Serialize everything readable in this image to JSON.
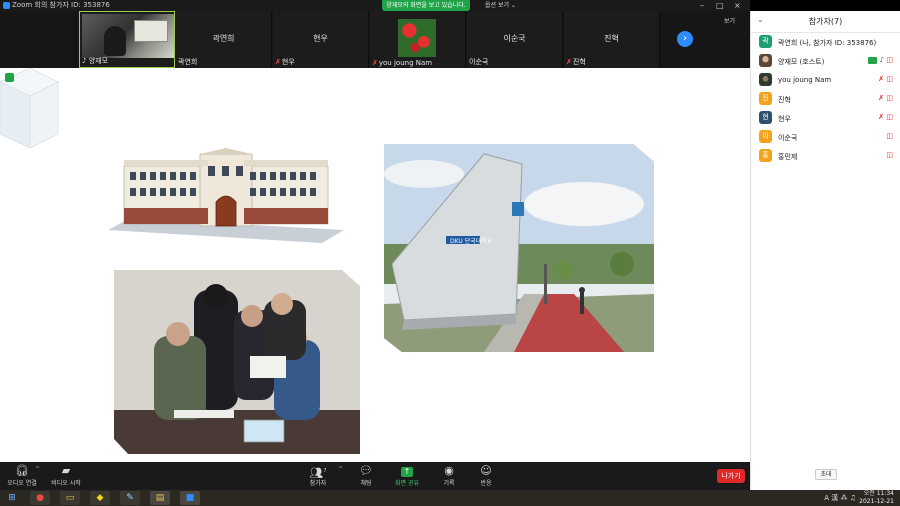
{
  "titlebar": {
    "app_title": "Zoom 회의 참가자 ID: 353876",
    "share_banner": "양재모의 화면을 보고 있습니다.",
    "view_options": "옵션 보기 ⌄",
    "minimize": "–",
    "maximize": "□",
    "close": "×"
  },
  "video_strip": {
    "tiles": [
      {
        "name": "양재모",
        "center_name": "",
        "muted": false,
        "active": true
      },
      {
        "name": "곽연희",
        "center_name": "곽연희",
        "muted": false,
        "active": false
      },
      {
        "name": "현우",
        "center_name": "현우",
        "muted": true,
        "active": false
      },
      {
        "name": "you joung Nam",
        "center_name": "",
        "muted": true,
        "active": false
      },
      {
        "name": "이순국",
        "center_name": "이순국",
        "muted": false,
        "active": false
      },
      {
        "name": "진혁",
        "center_name": "진혁",
        "muted": true,
        "active": false
      }
    ],
    "next_label": "›",
    "layout_button": "보기"
  },
  "toolbar": {
    "audio": "오디오 연결",
    "video": "비디오 시작",
    "participants": "참가자",
    "participants_count": "7",
    "chat": "채팅",
    "share": "화면 공유",
    "record": "기록",
    "reactions": "반응",
    "leave": "나가기"
  },
  "panel": {
    "title": "참가자(7)",
    "collapse_arrow": "⌄",
    "participants": [
      {
        "initial": "곽",
        "name": "곽연희 (나, 참가자 ID: 353876)",
        "color": "#1f9e72",
        "icons": ""
      },
      {
        "initial": "",
        "name": "양재모 (호스트)",
        "color": "",
        "icons": "host"
      },
      {
        "initial": "",
        "name": "you joung Nam",
        "color": "",
        "icons": "muted-video"
      },
      {
        "initial": "진",
        "name": "진혁",
        "color": "#f2a21b",
        "icons": "muted-video"
      },
      {
        "initial": "현",
        "name": "현우",
        "color": "#2f4f6f",
        "icons": "muted-video"
      },
      {
        "initial": "이",
        "name": "이순국",
        "color": "#f2a21b",
        "icons": "video-off"
      },
      {
        "initial": "홍",
        "name": "홍민제",
        "color": "#f2a21b",
        "icons": "video-off"
      }
    ],
    "invite_label": "초대"
  },
  "slide": {
    "campus_sign_text": "DKU 단국대학교"
  },
  "taskbar": {
    "tray_lang": "A 漢",
    "clock_time": "오전 11:34",
    "clock_date": "2021-12-21"
  }
}
